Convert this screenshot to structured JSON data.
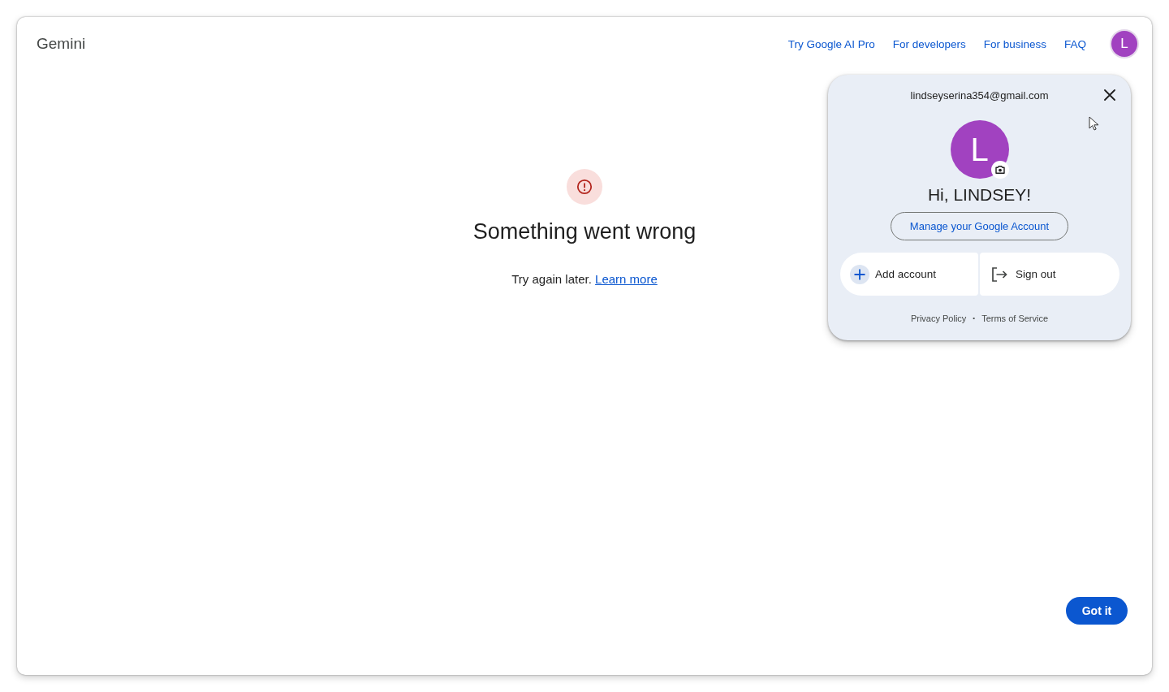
{
  "header": {
    "logo": "Gemini",
    "nav_links": [
      "Try Google AI Pro",
      "For developers",
      "For business",
      "FAQ"
    ],
    "avatar_initial": "L"
  },
  "error": {
    "title": "Something went wrong",
    "message": "Try again later.",
    "link": "Learn more"
  },
  "account_menu": {
    "email": "lindseyserina354@gmail.com",
    "avatar_initial": "L",
    "greeting": "Hi, LINDSEY!",
    "manage_button": "Manage your Google Account",
    "actions": [
      {
        "kind": "add",
        "label": "Add account"
      },
      {
        "kind": "sign_out",
        "label": "Sign out"
      }
    ],
    "footer": {
      "links": [
        "Privacy Policy",
        "Terms of Service"
      ],
      "separator": "•"
    }
  },
  "got_it_button": "Got it"
}
